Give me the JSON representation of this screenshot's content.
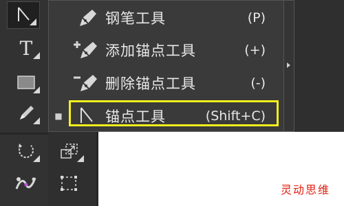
{
  "toolbar": {
    "tools": [
      {
        "name": "direct-selection-tool",
        "icon": "arrow-icon"
      },
      {
        "name": "type-tool",
        "icon": "type-icon",
        "glyph": "T"
      },
      {
        "name": "rectangle-tool",
        "icon": "rectangle-icon"
      },
      {
        "name": "pencil-tool",
        "icon": "pencil-icon"
      },
      {
        "name": "rotate-tool",
        "icon": "rotate-icon"
      },
      {
        "name": "scale-tool",
        "icon": "scale-icon"
      },
      {
        "name": "puppet-warp-tool",
        "icon": "puppet-warp-icon"
      },
      {
        "name": "free-transform-tool",
        "icon": "free-transform-icon"
      }
    ]
  },
  "menu": {
    "items": [
      {
        "label": "钢笔工具",
        "shortcut": "(P)",
        "icon": "pen-tool-icon",
        "selected": false
      },
      {
        "label": "添加锚点工具",
        "shortcut": "(+)",
        "icon": "add-anchor-point-icon",
        "selected": false
      },
      {
        "label": "删除锚点工具",
        "shortcut": "(-)",
        "icon": "delete-anchor-point-icon",
        "selected": false
      },
      {
        "label": "锚点工具",
        "shortcut": "(Shift+C)",
        "icon": "anchor-point-icon",
        "selected": true,
        "highlighted": true
      }
    ],
    "selected_mark": "■"
  },
  "watermark": "灵动思维",
  "colors": {
    "panel": "#323232",
    "menu_bg": "#3a3a3a",
    "highlight": "#f6f01c",
    "watermark": "#e02010",
    "canvas": "#ffffff"
  }
}
